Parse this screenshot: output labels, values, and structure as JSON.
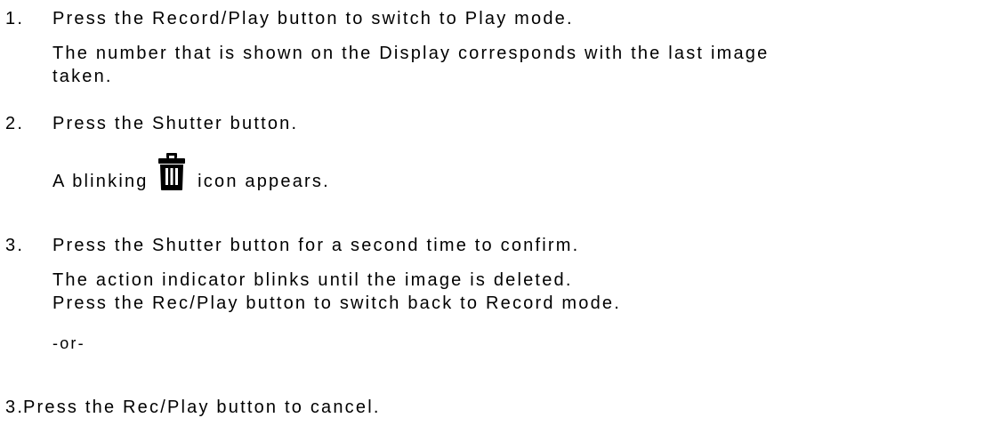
{
  "steps": [
    {
      "number": "1.",
      "instruction": "Press the Record/Play button to switch to Play mode.",
      "notes": [
        "The number that is shown on the Display corresponds with the last image",
        "taken."
      ]
    },
    {
      "number": "2.",
      "instruction": "Press the Shutter button.",
      "note_before_icon": "A blinking",
      "icon": "trash-can-icon",
      "note_after_icon": "icon appears."
    },
    {
      "number": "3.",
      "instruction": "Press the Shutter button for a second time to confirm.",
      "notes": [
        "The action indicator blinks until the image is deleted.",
        "Press the Rec/Play button to switch back to Record mode."
      ],
      "alternative": "-or-"
    },
    {
      "number": "3.",
      "instruction": "Press the Rec/Play button to cancel."
    }
  ],
  "colors": {
    "text": "#000000",
    "background": "#ffffff"
  }
}
